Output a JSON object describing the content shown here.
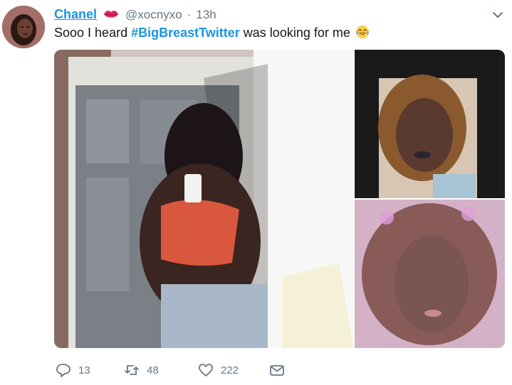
{
  "tweet": {
    "author_name": "Chanel",
    "handle": "@xocnyxo",
    "separator": "·",
    "timestamp": "13h",
    "text_before": "Sooo I heard ",
    "hashtag": "#BigBreastTwitter",
    "text_after": " was looking for me",
    "emoji": "tears-of-joy"
  },
  "media": {
    "photo_count": 3
  },
  "actions": {
    "replies": "13",
    "retweets": "48",
    "likes": "222"
  },
  "colors": {
    "link_blue": "#1b95e0",
    "muted_gray": "#657786",
    "text_dark": "#14171a"
  },
  "icons": [
    "lips-icon",
    "caret-down-icon",
    "tears-of-joy-emoji-icon",
    "reply-icon",
    "retweet-icon",
    "like-icon",
    "direct-message-icon"
  ]
}
